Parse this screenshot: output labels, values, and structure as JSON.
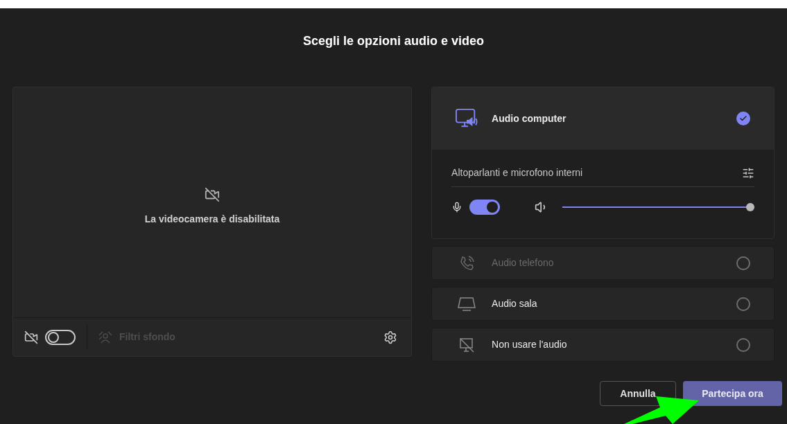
{
  "title": "Scegli le opzioni audio e video",
  "video": {
    "status": "La videocamera è disabilitata",
    "camera_on": false,
    "background_filters": {
      "label": "Filtri sfondo",
      "disabled": true
    }
  },
  "audio_options": [
    {
      "kind": "computer",
      "label": "Audio computer",
      "selected": true,
      "disabled": false
    },
    {
      "kind": "phone",
      "label": "Audio telefono",
      "selected": false,
      "disabled": true
    },
    {
      "kind": "room",
      "label": "Audio sala",
      "selected": false,
      "disabled": false
    },
    {
      "kind": "none",
      "label": "Non usare l'audio",
      "selected": false,
      "disabled": false
    }
  ],
  "device": {
    "label": "Altoparlanti e microfono interni",
    "mic_on": true,
    "volume": {
      "level": 1
    }
  },
  "buttons": [
    {
      "kind": "secondary",
      "label": "Annulla"
    },
    {
      "kind": "primary",
      "label": "Partecipa ora"
    }
  ],
  "annotation_arrow": true
}
